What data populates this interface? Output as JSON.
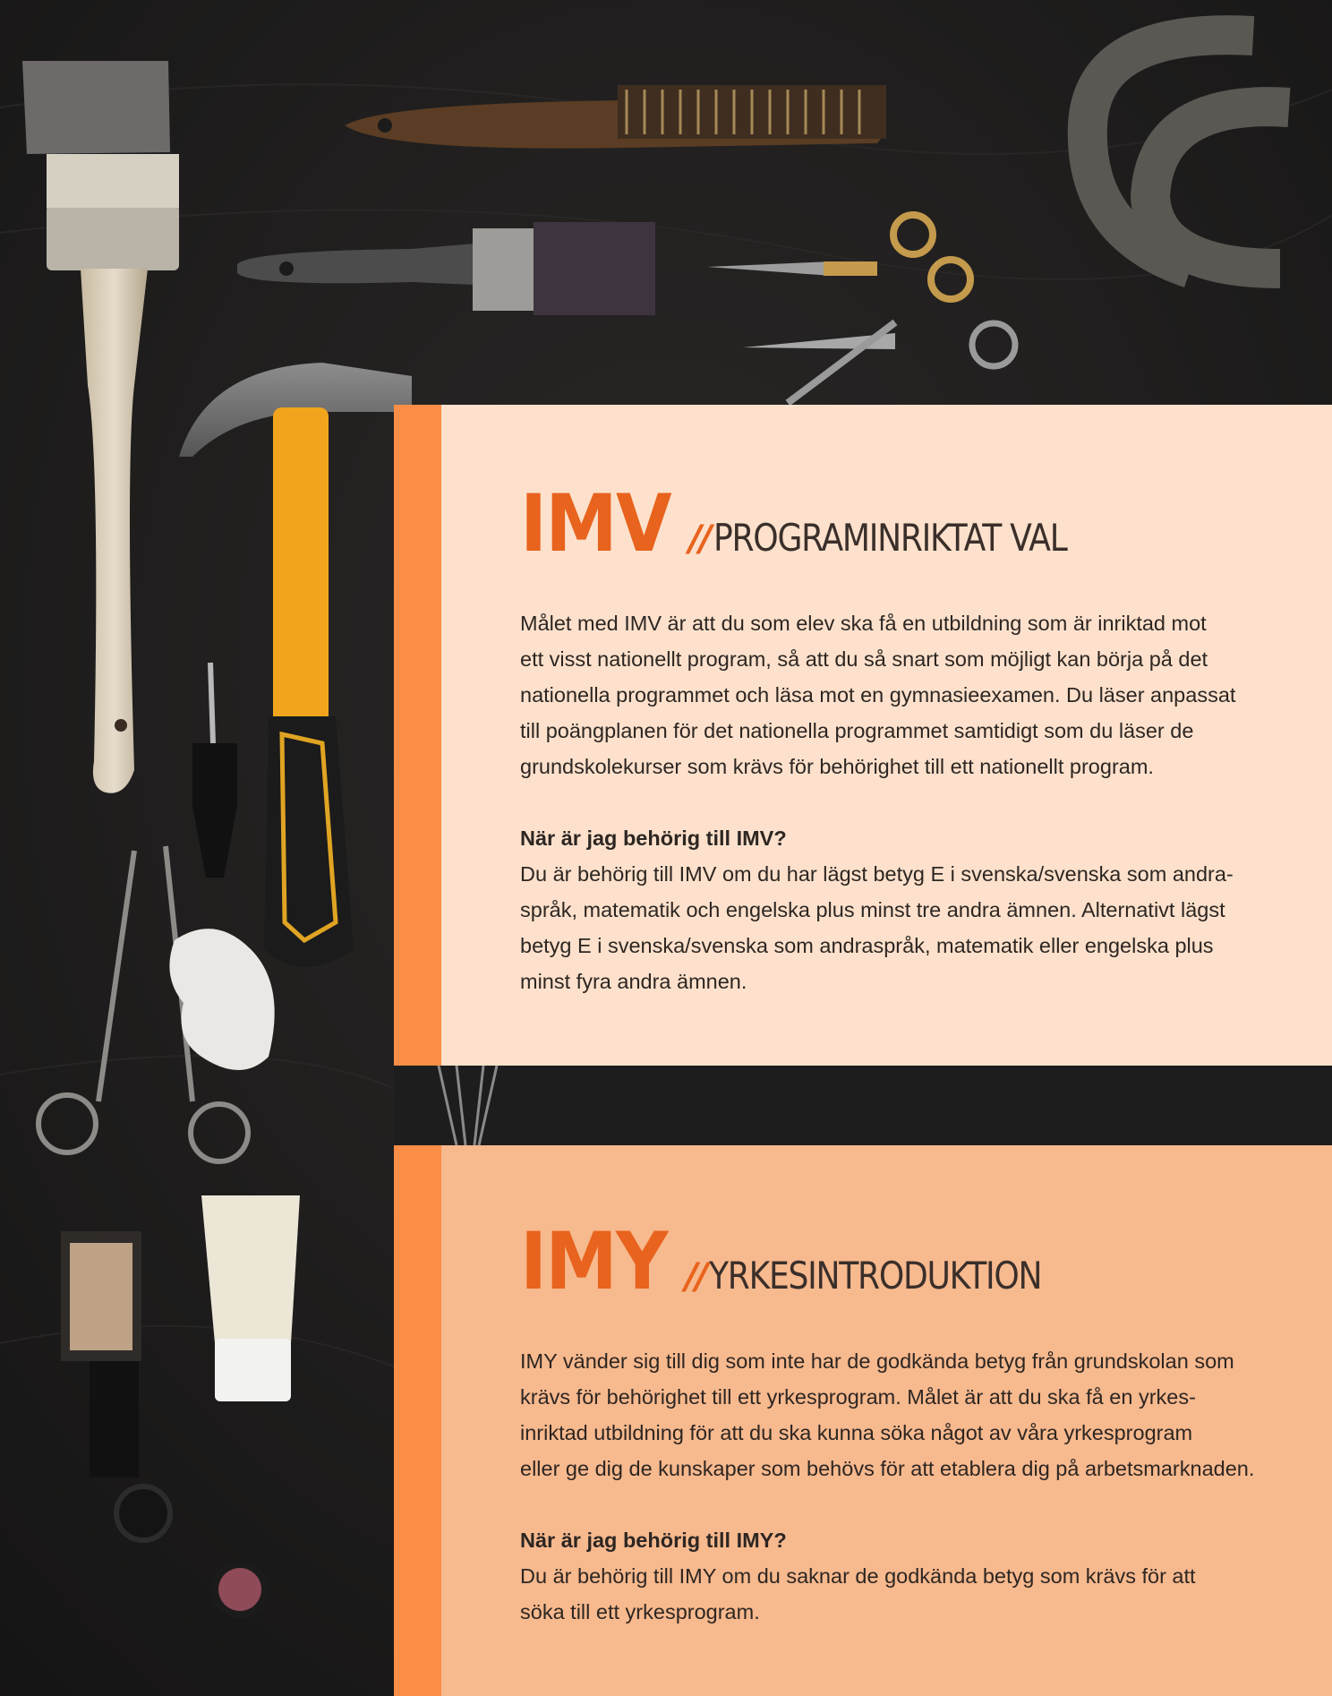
{
  "colors": {
    "accent": "#e8631d",
    "stripe": "#fa8e46",
    "imv_panel_bg": "#fde1cc",
    "imy_panel_bg": "#f7b98e",
    "background": "#1c1b1b"
  },
  "background_photo": {
    "icons": [
      "paintbrush-icon",
      "wire-brush-icon",
      "horseshoe-icon",
      "flat-brush-icon",
      "scissors-icon",
      "thinning-scissors-icon",
      "hammer-icon",
      "drill-bit-icon",
      "forceps-icon",
      "tissue-icon",
      "cream-tube-icon",
      "foundation-bottle-icon",
      "lipstick-icon"
    ]
  },
  "imv": {
    "code": "IMV",
    "slashes": "//",
    "subtitle": "PROGRAMINRIKTAT VAL",
    "intro": "Målet med IMV är att du som elev ska få en utbildning som är inriktad mot\nett visst nationellt program, så att du så snart som möjligt kan börja på det\nnationella programmet och läsa mot en gymnasieexamen. Du läser anpassat\ntill poängplanen för det nationella programmet samtidigt som du läser de\ngrundskolekurser som krävs för behörighet till ett nationellt program.",
    "question": "När är jag behörig till IMV?",
    "answer": "Du är behörig till IMV om du har lägst betyg E i svenska/svenska som andra-\nspråk, matematik och engelska plus minst tre andra ämnen. Alternativt lägst\nbetyg E i svenska/svenska som andraspråk, matematik eller engelska plus\nminst fyra andra ämnen."
  },
  "imy": {
    "code": "IMY",
    "slashes": "//",
    "subtitle": "YRKESINTRODUKTION",
    "intro": "IMY vänder sig till dig som inte har de godkända betyg från grundskolan som\nkrävs för behörighet till ett yrkesprogram. Målet är att du ska få en yrkes-\ninriktad utbildning för att du ska kunna söka något av våra yrkesprogram\neller ge dig de kunskaper som behövs för att etablera dig på arbetsmarknaden.",
    "question": "När är jag behörig till IMY?",
    "answer": "Du är behörig till IMY om du saknar de godkända betyg som krävs för att\nsöka till ett yrkesprogram."
  }
}
